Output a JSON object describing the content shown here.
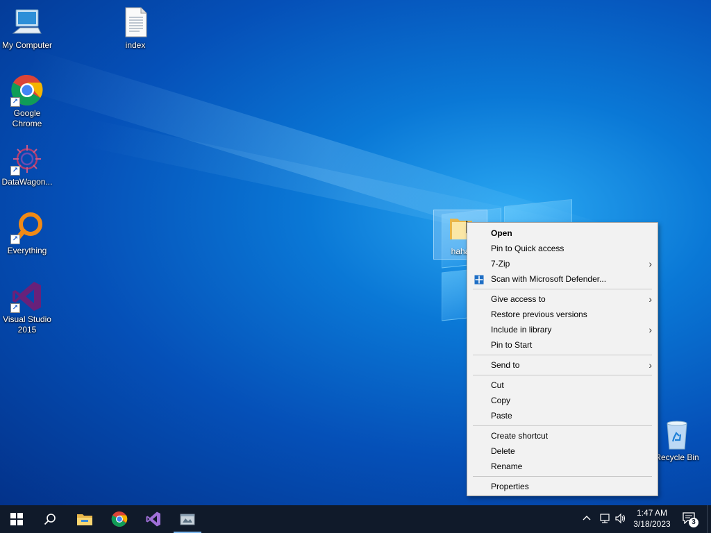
{
  "desktop": {
    "icons": [
      {
        "label": "My Computer",
        "icon": "computer-icon"
      },
      {
        "label": "index",
        "icon": "text-file-icon"
      },
      {
        "label": "Google Chrome",
        "icon": "chrome-icon"
      },
      {
        "label": "DataWagon...",
        "icon": "datawagon-icon"
      },
      {
        "label": "Everything",
        "icon": "everything-search-icon"
      },
      {
        "label": "Visual Studio 2015",
        "icon": "visual-studio-icon"
      },
      {
        "label": "Recycle Bin",
        "icon": "recycle-bin-icon"
      }
    ],
    "selected_folder_label": "haha"
  },
  "context_menu": {
    "items": [
      {
        "label": "Open",
        "bold": true
      },
      {
        "label": "Pin to Quick access"
      },
      {
        "label": "7-Zip",
        "submenu": true
      },
      {
        "label": "Scan with Microsoft Defender...",
        "icon": "defender-shield-icon"
      },
      {
        "label": "Give access to",
        "submenu": true
      },
      {
        "label": "Restore previous versions"
      },
      {
        "label": "Include in library",
        "submenu": true
      },
      {
        "label": "Pin to Start"
      },
      {
        "label": "Send to",
        "submenu": true
      },
      {
        "label": "Cut"
      },
      {
        "label": "Copy"
      },
      {
        "label": "Paste"
      },
      {
        "label": "Create shortcut"
      },
      {
        "label": "Delete"
      },
      {
        "label": "Rename"
      },
      {
        "label": "Properties"
      }
    ],
    "submenu_arrow": "›"
  },
  "taskbar": {
    "buttons": [
      "windows-start-icon",
      "search-icon",
      "file-explorer-icon",
      "chrome-icon",
      "visual-studio-icon",
      "app-window-icon"
    ],
    "clock": {
      "time": "1:47 AM",
      "date": "3/18/2023"
    },
    "notification_count": "3",
    "colors": {
      "background": "#101a2a",
      "accent": "#7cb8f0"
    }
  }
}
